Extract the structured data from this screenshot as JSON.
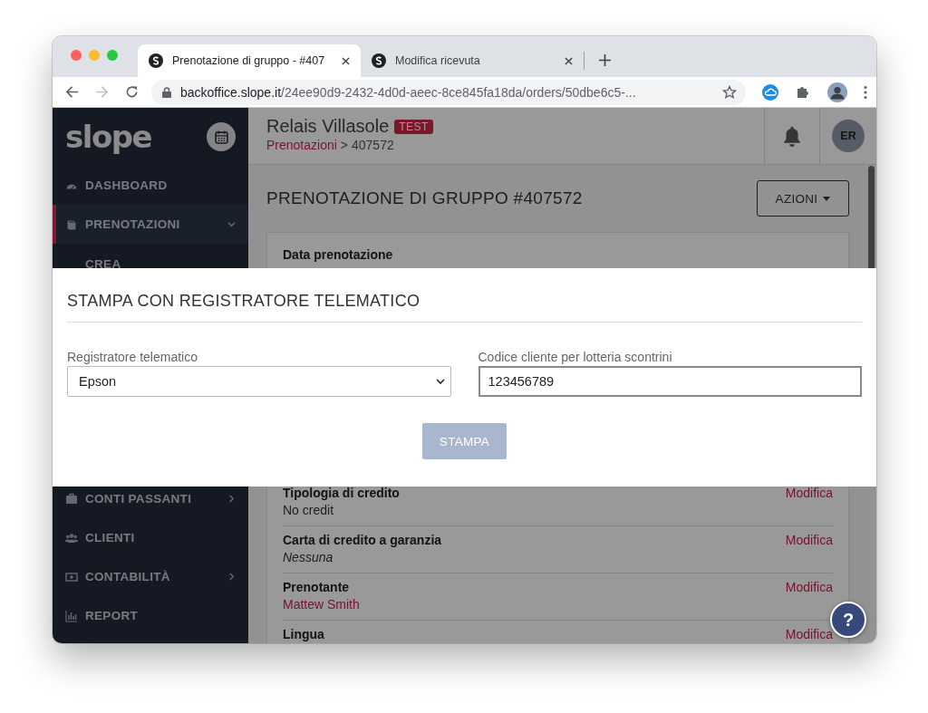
{
  "browser": {
    "tabs": [
      {
        "title": "Prenotazione di gruppo - #407",
        "selected": true
      },
      {
        "title": "Modifica ricevuta",
        "selected": false
      }
    ],
    "url_host": "backoffice.slope.it",
    "url_path": "/24ee90d9-2432-4d0d-aeec-8ce845fa18da/orders/50dbe6c5-..."
  },
  "sidebar": {
    "logo": "slope",
    "items": [
      {
        "label": "DASHBOARD",
        "kind": "link",
        "selected": false
      },
      {
        "label": "PRENOTAZIONI",
        "kind": "group",
        "selected": true,
        "expanded": true
      },
      {
        "label": "CREA",
        "kind": "sub",
        "selected": false
      }
    ],
    "lower_items": [
      {
        "label": "CONTI PASSANTI",
        "kind": "group",
        "selected": false,
        "expanded": false
      },
      {
        "label": "CLIENTI",
        "kind": "link",
        "selected": false
      },
      {
        "label": "CONTABILITÀ",
        "kind": "group",
        "selected": false,
        "expanded": false
      },
      {
        "label": "REPORT",
        "kind": "link",
        "selected": false
      }
    ]
  },
  "header": {
    "hotel": "Relais Villasole",
    "badge": "TEST",
    "breadcrumb": [
      {
        "label": "Prenotazioni",
        "kind": "link"
      },
      {
        "label": "407572",
        "kind": "text"
      }
    ],
    "separator": ">",
    "avatar": "ER"
  },
  "page": {
    "title": "PRENOTAZIONE DI GRUPPO #407572",
    "actions": "AZIONI"
  },
  "details": {
    "top_label": "Data prenotazione",
    "rows": [
      {
        "label": "Tipologia di credito",
        "value": "No credit",
        "kind": "plain",
        "action": "Modifica"
      },
      {
        "label": "Carta di credito a garanzia",
        "value": "Nessuna",
        "kind": "italic",
        "action": "Modifica"
      },
      {
        "label": "Prenotante",
        "value": "Mattew Smith",
        "kind": "link",
        "action": "Modifica"
      },
      {
        "label": "Lingua",
        "action": "Modifica"
      }
    ]
  },
  "modal": {
    "title": "STAMPA CON REGISTRATORE TELEMATICO",
    "fields": [
      {
        "kind": "select",
        "label": "Registratore telematico",
        "value": "Epson"
      },
      {
        "kind": "input",
        "label": "Codice cliente per lotteria scontrini",
        "value": "123456789"
      }
    ],
    "button": {
      "label": "STAMPA",
      "disabled": true
    }
  },
  "help": "?"
}
